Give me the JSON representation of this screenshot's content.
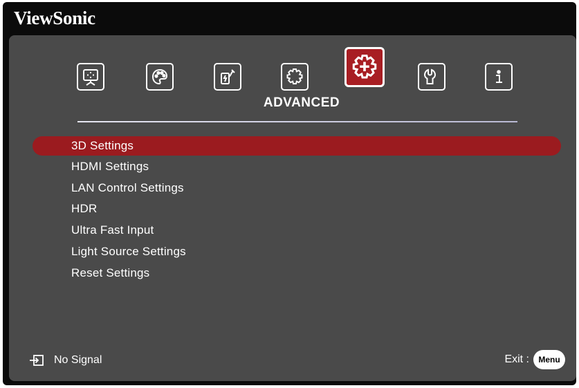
{
  "brand": "ViewSonic",
  "tabs": [
    {
      "icon": "display-icon",
      "active": false
    },
    {
      "icon": "palette-icon",
      "active": false
    },
    {
      "icon": "power-plug-icon",
      "active": false
    },
    {
      "icon": "gear-icon",
      "active": false
    },
    {
      "icon": "advanced-gear-plus-icon",
      "active": true
    },
    {
      "icon": "wrench-icon",
      "active": false
    },
    {
      "icon": "info-icon",
      "active": false
    }
  ],
  "active_tab_title": "ADVANCED",
  "menu": {
    "items": [
      {
        "label": "3D Settings",
        "selected": true
      },
      {
        "label": "HDMI Settings",
        "selected": false
      },
      {
        "label": "LAN Control Settings",
        "selected": false
      },
      {
        "label": "HDR",
        "selected": false
      },
      {
        "label": "Ultra Fast Input",
        "selected": false
      },
      {
        "label": "Light Source Settings",
        "selected": false
      },
      {
        "label": "Reset Settings",
        "selected": false
      }
    ]
  },
  "footer": {
    "input_icon": "input-source-icon",
    "status": "No Signal",
    "exit_label": "Exit :",
    "menu_button": "Menu"
  },
  "colors": {
    "accent": "#a81e23",
    "highlight": "#9b1b1f",
    "panel": "#4a4a4a",
    "frame": "#0b0b0b"
  }
}
